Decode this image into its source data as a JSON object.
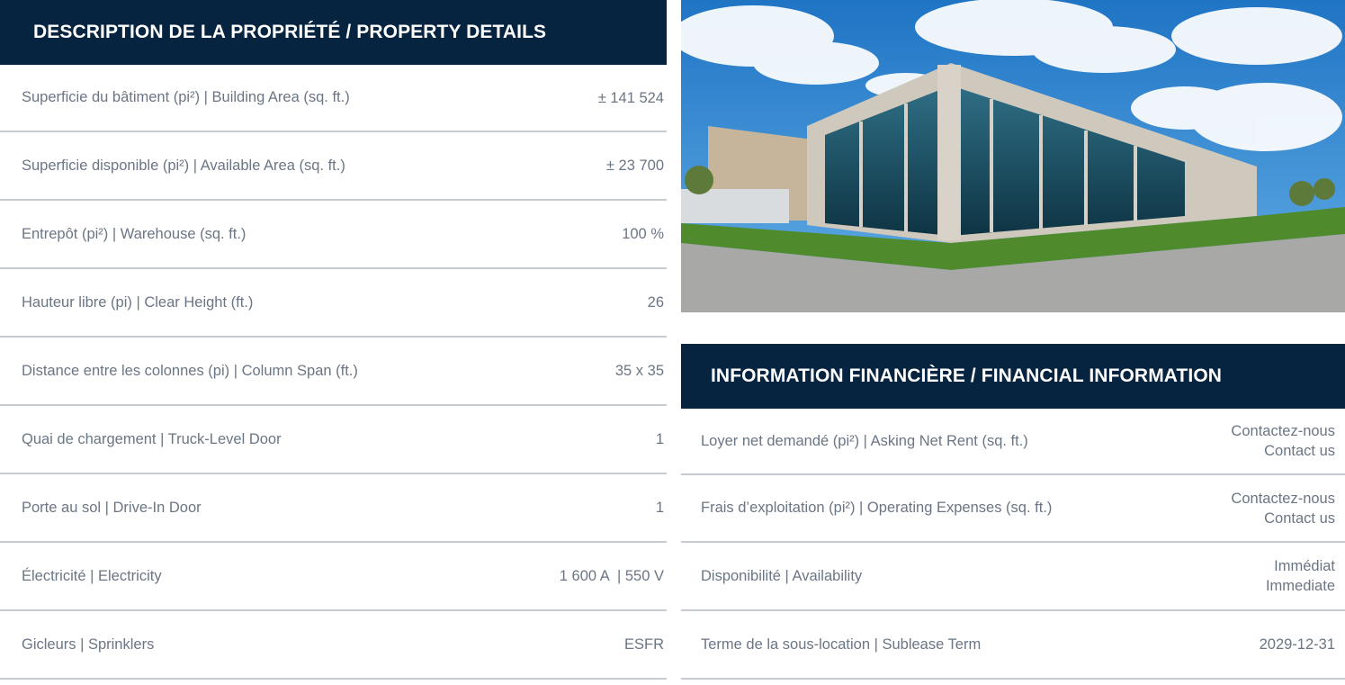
{
  "property": {
    "title": "DESCRIPTION DE LA PROPRIÉTÉ / PROPERTY DETAILS",
    "rows": [
      {
        "label": "Superficie du bâtiment (pi²) | Building Area (sq. ft.)",
        "value": "± 141 524"
      },
      {
        "label": "Superficie disponible (pi²) | Available Area (sq. ft.)",
        "value": "± 23 700"
      },
      {
        "label": "Entrepôt (pi²) | Warehouse (sq. ft.)",
        "value": "100 %"
      },
      {
        "label": "Hauteur libre (pi) | Clear Height (ft.)",
        "value": "26"
      },
      {
        "label": "Distance entre les colonnes (pi) | Column Span (ft.)",
        "value": "35 x 35"
      },
      {
        "label": "Quai de chargement | Truck-Level Door",
        "value": "1"
      },
      {
        "label": "Porte au sol | Drive-In Door",
        "value": "1"
      },
      {
        "label": "Électricité | Electricity",
        "value": "1 600 A  | 550 V"
      },
      {
        "label": "Gicleurs | Sprinklers",
        "value": "ESFR"
      }
    ]
  },
  "financial": {
    "title": "INFORMATION FINANCIÈRE / FINANCIAL INFORMATION",
    "rows": [
      {
        "label": "Loyer net demandé (pi²) | Asking Net Rent (sq. ft.)",
        "value_fr": "Contactez-nous",
        "value_en": "Contact us"
      },
      {
        "label": "Frais d’exploitation (pi²) | Operating Expenses (sq. ft.)",
        "value_fr": "Contactez-nous",
        "value_en": "Contact us"
      },
      {
        "label": "Disponibilité | Availability",
        "value_fr": "Immédiat",
        "value_en": "Immediate"
      },
      {
        "label": "Terme de la sous-location | Sublease Term",
        "value_fr": "2029-12-31",
        "value_en": ""
      }
    ]
  },
  "colors": {
    "header_bg": "#06233f",
    "header_text": "#ffffff",
    "body_text": "#6b7684",
    "divider": "#c6cbd2"
  }
}
